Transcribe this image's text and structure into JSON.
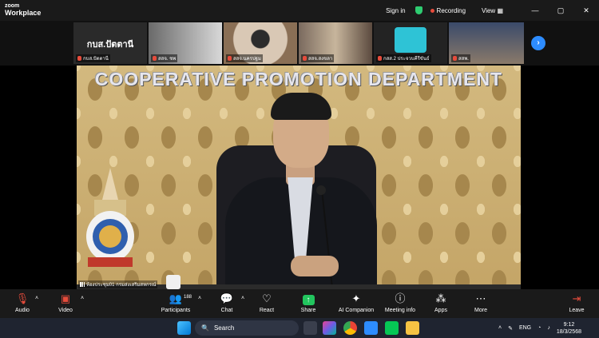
{
  "app": {
    "logo_line1": "zoom",
    "logo_line2": "Workplace"
  },
  "titlebar": {
    "signin": "Sign in",
    "recording": "Recording",
    "view": "View",
    "minimize": "—",
    "maximize": "▢",
    "close": "✕"
  },
  "participants": [
    {
      "name": "กบส.ปัตตานี",
      "big_label": "กบส.ปัตตานี"
    },
    {
      "name": "สสจ. ชพ",
      "big_label": ""
    },
    {
      "name": "สสจ.นครปฐม",
      "big_label": ""
    },
    {
      "name": "สสจ.สงขลา",
      "big_label": ""
    },
    {
      "name": "กสส.2 ประจวบคีรีขันธ์",
      "big_label": ""
    },
    {
      "name": "สสพ.",
      "big_label": ""
    }
  ],
  "next_button": "›",
  "main_video": {
    "sign": "COOPERATIVE PROMOTION DEPARTMENT",
    "room_label": "ห้องประชุม01 กรมส่งเสริมสหกรณ์"
  },
  "toolbar": {
    "audio": "Audio",
    "video": "Video",
    "participants": "Participants",
    "participants_count": "188",
    "chat": "Chat",
    "react": "React",
    "share": "Share",
    "ai_companion": "AI Companion",
    "meeting_info": "Meeting info",
    "apps": "Apps",
    "more": "More",
    "leave": "Leave"
  },
  "taskbar": {
    "search_placeholder": "Search",
    "lang": "ENG",
    "time": "9:12",
    "date": "18/3/2568"
  }
}
